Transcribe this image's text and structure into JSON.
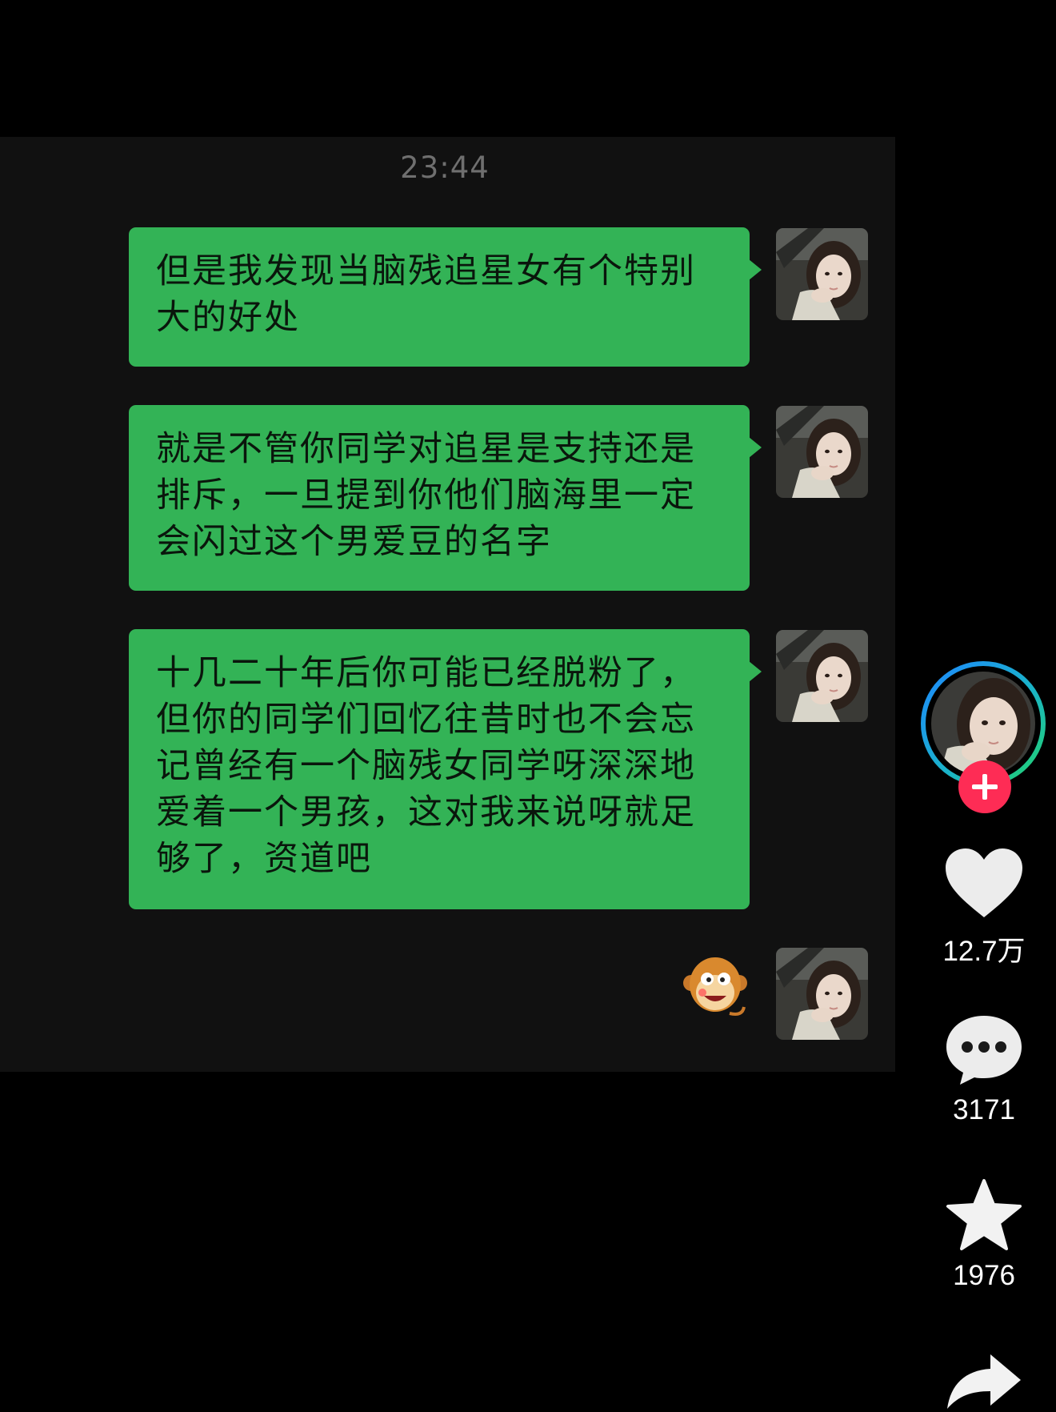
{
  "chat": {
    "timestamp": "23:44",
    "messages": [
      {
        "lines": [
          "但是我发现当脑残追星女有个特别",
          "大的好处"
        ]
      },
      {
        "lines": [
          "就是不管你同学对追星是支持还是",
          "排斥，一旦提到你他们脑海里一定",
          "会闪过这个男爱豆的名字"
        ]
      },
      {
        "lines": [
          "十几二十年后你可能已经脱粉了，",
          "但你的同学们回忆往昔时也不会忘",
          "记曾经有一个脑残女同学呀深深地",
          "爱着一个男孩，这对我来说呀就足",
          "够了，资道吧"
        ]
      }
    ],
    "last_message_type": "monkey-sticker"
  },
  "sidebar": {
    "likes_count": "12.7万",
    "comments_count": "3171",
    "favorites_count": "1976"
  },
  "colors": {
    "bubble_green": "#33b356",
    "chat_background": "#111111",
    "follow_red": "#fe2c55",
    "ring_blue": "#1e88ff",
    "ring_green": "#22d36a"
  },
  "icons": [
    "heart-icon",
    "comment-icon",
    "star-icon",
    "share-icon",
    "plus-icon"
  ]
}
